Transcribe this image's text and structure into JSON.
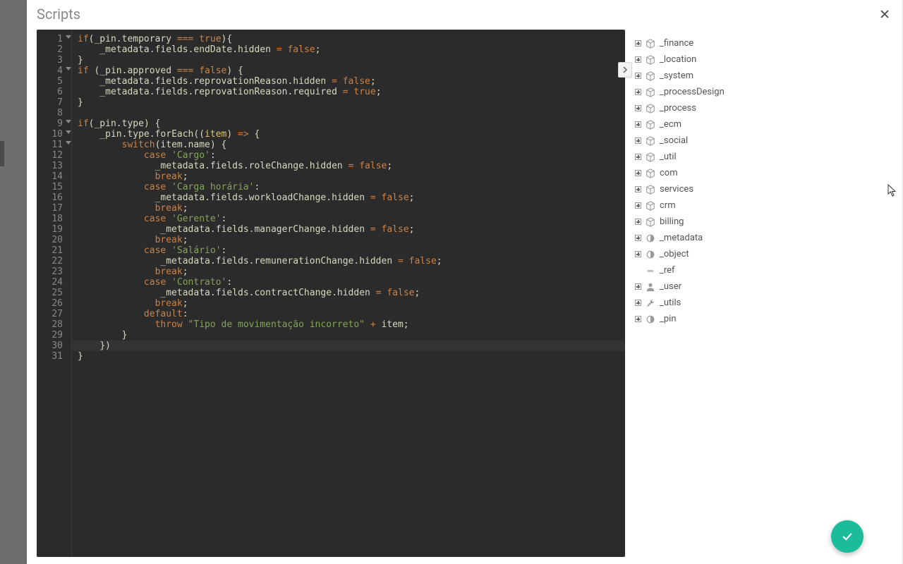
{
  "panel": {
    "title": "Scripts"
  },
  "editor": {
    "highlight_line_index": 29,
    "lines": [
      {
        "n": 1,
        "fold": true,
        "html": "<span class='kw'>if</span><span class='punct'>(</span><span class='id'>_pin</span><span class='punct'>.</span><span class='id'>temporary</span> <span class='op'>===</span> <span class='bool'>true</span><span class='punct'>){</span>"
      },
      {
        "n": 2,
        "fold": false,
        "html": "    <span class='id'>_metadata</span><span class='punct'>.</span><span class='id'>fields</span><span class='punct'>.</span><span class='id'>endDate</span><span class='punct'>.</span><span class='id'>hidden</span> <span class='op'>=</span> <span class='bool'>false</span><span class='punct'>;</span>"
      },
      {
        "n": 3,
        "fold": false,
        "html": "<span class='punct'>}</span>"
      },
      {
        "n": 4,
        "fold": true,
        "html": "<span class='kw'>if</span> <span class='punct'>(</span><span class='id'>_pin</span><span class='punct'>.</span><span class='id'>approved</span> <span class='op'>===</span> <span class='bool'>false</span><span class='punct'>) {</span>"
      },
      {
        "n": 5,
        "fold": false,
        "html": "    <span class='id'>_metadata</span><span class='punct'>.</span><span class='id'>fields</span><span class='punct'>.</span><span class='id'>reprovationReason</span><span class='punct'>.</span><span class='id'>hidden</span> <span class='op'>=</span> <span class='bool'>false</span><span class='punct'>;</span>"
      },
      {
        "n": 6,
        "fold": false,
        "html": "    <span class='id'>_metadata</span><span class='punct'>.</span><span class='id'>fields</span><span class='punct'>.</span><span class='id'>reprovationReason</span><span class='punct'>.</span><span class='id'>required</span> <span class='op'>=</span> <span class='bool'>true</span><span class='punct'>;</span>"
      },
      {
        "n": 7,
        "fold": false,
        "html": "<span class='punct'>}</span>"
      },
      {
        "n": 8,
        "fold": false,
        "html": ""
      },
      {
        "n": 9,
        "fold": true,
        "html": "<span class='kw'>if</span><span class='punct'>(</span><span class='id'>_pin</span><span class='punct'>.</span><span class='id'>type</span><span class='punct'>) {</span>"
      },
      {
        "n": 10,
        "fold": true,
        "html": "    <span class='id'>_pin</span><span class='punct'>.</span><span class='id'>type</span><span class='punct'>.</span><span class='id'>forEach</span><span class='punct'>((</span><span class='param'>item</span><span class='punct'>)</span> <span class='op'>=&gt;</span> <span class='punct'>{</span>"
      },
      {
        "n": 11,
        "fold": true,
        "html": "        <span class='kw'>switch</span><span class='punct'>(</span><span class='id'>item</span><span class='punct'>.</span><span class='id'>name</span><span class='punct'>) {</span>"
      },
      {
        "n": 12,
        "fold": false,
        "html": "            <span class='kw'>case</span> <span class='str'>'Cargo'</span><span class='punct'>:</span>"
      },
      {
        "n": 13,
        "fold": false,
        "html": "              <span class='id'>_metadata</span><span class='punct'>.</span><span class='id'>fields</span><span class='punct'>.</span><span class='id'>roleChange</span><span class='punct'>.</span><span class='id'>hidden</span> <span class='op'>=</span> <span class='bool'>false</span><span class='punct'>;</span>"
      },
      {
        "n": 14,
        "fold": false,
        "html": "              <span class='kw'>break</span><span class='punct'>;</span>"
      },
      {
        "n": 15,
        "fold": false,
        "html": "            <span class='kw'>case</span> <span class='str'>'Carga hor&aacute;ria'</span><span class='punct'>:</span>"
      },
      {
        "n": 16,
        "fold": false,
        "html": "              <span class='id'>_metadata</span><span class='punct'>.</span><span class='id'>fields</span><span class='punct'>.</span><span class='id'>workloadChange</span><span class='punct'>.</span><span class='id'>hidden</span> <span class='op'>=</span> <span class='bool'>false</span><span class='punct'>;</span>"
      },
      {
        "n": 17,
        "fold": false,
        "html": "              <span class='kw'>break</span><span class='punct'>;</span>"
      },
      {
        "n": 18,
        "fold": false,
        "html": "            <span class='kw'>case</span> <span class='str'>'Gerente'</span><span class='punct'>:</span>"
      },
      {
        "n": 19,
        "fold": false,
        "html": "               <span class='id'>_metadata</span><span class='punct'>.</span><span class='id'>fields</span><span class='punct'>.</span><span class='id'>managerChange</span><span class='punct'>.</span><span class='id'>hidden</span> <span class='op'>=</span> <span class='bool'>false</span><span class='punct'>;</span>"
      },
      {
        "n": 20,
        "fold": false,
        "html": "              <span class='kw'>break</span><span class='punct'>;</span>"
      },
      {
        "n": 21,
        "fold": false,
        "html": "            <span class='kw'>case</span> <span class='str'>'Sal&aacute;rio'</span><span class='punct'>:</span>"
      },
      {
        "n": 22,
        "fold": false,
        "html": "               <span class='id'>_metadata</span><span class='punct'>.</span><span class='id'>fields</span><span class='punct'>.</span><span class='id'>remunerationChange</span><span class='punct'>.</span><span class='id'>hidden</span> <span class='op'>=</span> <span class='bool'>false</span><span class='punct'>;</span>"
      },
      {
        "n": 23,
        "fold": false,
        "html": "              <span class='kw'>break</span><span class='punct'>;</span>"
      },
      {
        "n": 24,
        "fold": false,
        "html": "            <span class='kw'>case</span> <span class='str'>'Contrato'</span><span class='punct'>:</span>"
      },
      {
        "n": 25,
        "fold": false,
        "html": "               <span class='id'>_metadata</span><span class='punct'>.</span><span class='id'>fields</span><span class='punct'>.</span><span class='id'>contractChange</span><span class='punct'>.</span><span class='id'>hidden</span> <span class='op'>=</span> <span class='bool'>false</span><span class='punct'>;</span>"
      },
      {
        "n": 26,
        "fold": false,
        "html": "              <span class='kw'>break</span><span class='punct'>;</span>"
      },
      {
        "n": 27,
        "fold": false,
        "html": "            <span class='kw'>default</span><span class='punct'>:</span>"
      },
      {
        "n": 28,
        "fold": false,
        "html": "              <span class='kw'>throw</span> <span class='str'>\"Tipo de movimenta&ccedil;&atilde;o incorreto\"</span> <span class='op'>+</span> <span class='id'>item</span><span class='punct'>;</span>"
      },
      {
        "n": 29,
        "fold": false,
        "html": "        <span class='punct'>}</span>"
      },
      {
        "n": 30,
        "fold": false,
        "html": "    <span class='punct'>})</span>"
      },
      {
        "n": 31,
        "fold": false,
        "html": "<span class='punct'>}</span>"
      }
    ]
  },
  "tree": {
    "nodes": [
      {
        "label": "_finance",
        "icon": "cube",
        "expand": true
      },
      {
        "label": "_location",
        "icon": "cube",
        "expand": true
      },
      {
        "label": "_system",
        "icon": "cube",
        "expand": true
      },
      {
        "label": "_processDesign",
        "icon": "cube",
        "expand": true
      },
      {
        "label": "_process",
        "icon": "cube",
        "expand": true
      },
      {
        "label": "_ecm",
        "icon": "cube",
        "expand": true
      },
      {
        "label": "_social",
        "icon": "cube",
        "expand": true
      },
      {
        "label": "_util",
        "icon": "cube",
        "expand": true
      },
      {
        "label": "com",
        "icon": "cube",
        "expand": true
      },
      {
        "label": "services",
        "icon": "cube",
        "expand": true
      },
      {
        "label": "crm",
        "icon": "cube",
        "expand": true
      },
      {
        "label": "billing",
        "icon": "cube",
        "expand": true
      },
      {
        "label": "_metadata",
        "icon": "circle",
        "expand": true
      },
      {
        "label": "_object",
        "icon": "circle",
        "expand": true
      },
      {
        "label": "_ref",
        "icon": "dash",
        "expand": false
      },
      {
        "label": "_user",
        "icon": "user",
        "expand": true
      },
      {
        "label": "_utils",
        "icon": "wrench",
        "expand": true
      },
      {
        "label": "_pin",
        "icon": "circle",
        "expand": true
      }
    ]
  }
}
